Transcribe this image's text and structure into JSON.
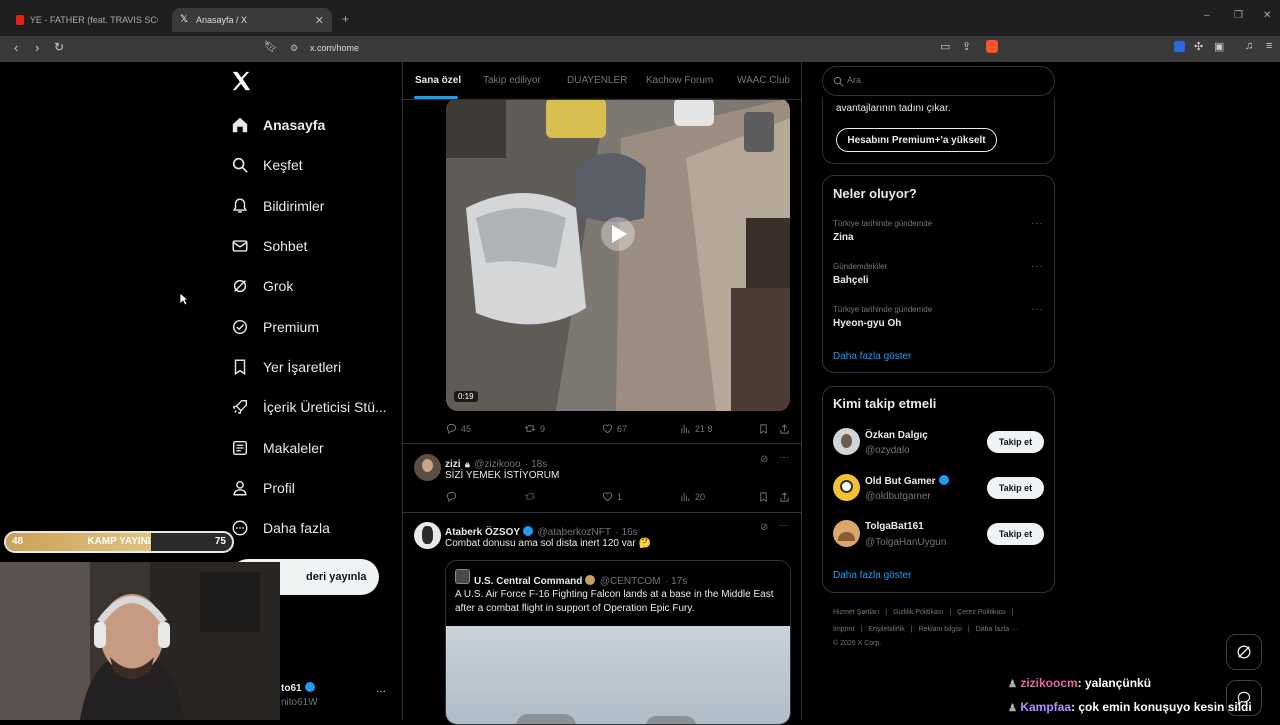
{
  "browser": {
    "tabs": [
      {
        "label": "YE - FATHER (feat. TRAVIS SCOTT) - Y"
      },
      {
        "label": "Anasayfa / X"
      }
    ],
    "new_tab": "+",
    "url": "x.com/home",
    "window_controls": [
      "–",
      "❐",
      "✕"
    ]
  },
  "nav": {
    "items": [
      {
        "label": "Anasayfa",
        "icon": "home-icon"
      },
      {
        "label": "Keşfet",
        "icon": "search-icon"
      },
      {
        "label": "Bildirimler",
        "icon": "bell-icon"
      },
      {
        "label": "Sohbet",
        "icon": "mail-icon"
      },
      {
        "label": "Grok",
        "icon": "grok-icon"
      },
      {
        "label": "Premium",
        "icon": "premium-icon"
      },
      {
        "label": "Yer İşaretleri",
        "icon": "bookmark-icon"
      },
      {
        "label": "İçerik Üreticisi Stü...",
        "icon": "rocket-icon"
      },
      {
        "label": "Makaleler",
        "icon": "article-icon"
      },
      {
        "label": "Profil",
        "icon": "person-icon"
      },
      {
        "label": "Daha fazla",
        "icon": "more-circle-icon"
      }
    ],
    "post_button": "deri yayınla",
    "account_name": "to61",
    "account_handle": "nito61W",
    "account_more": "···"
  },
  "feed": {
    "tabs": [
      "Sana özel",
      "Takip ediliyor",
      "DUAYENLER",
      "Kachow Forum",
      "WAAC Club"
    ],
    "video_duration": "0:19",
    "first_tweet_actions": {
      "replies": "45",
      "reposts": "9",
      "likes": "67",
      "views": "21 8"
    },
    "tweets": [
      {
        "name": "zizi",
        "handle": "@zizikooo",
        "time": "· 18s",
        "text": "SİZİ YEMEK İSTİYORUM",
        "likes": "1",
        "views": "20"
      },
      {
        "name": "Ataberk ÖZSOY",
        "handle": "@ataberkozNFT",
        "time": "· 16s",
        "text": "Combat donusu ama sol dista inert 120 var 🤔",
        "quote": {
          "name": "U.S. Central Command",
          "handle": "@CENTCOM",
          "time": "· 17s",
          "text_line1": "A U.S. Air Force F-16 Fighting Falcon lands at a base in the Middle East",
          "text_line2": "after a combat flight in support of Operation Epic Fury."
        }
      }
    ]
  },
  "right": {
    "search_placeholder": "Ara",
    "premium": {
      "text": "avantajlarının tadını çıkar.",
      "button": "Hesabını Premium+'a yükselt"
    },
    "trends": {
      "title": "Neler oluyor?",
      "items": [
        {
          "meta": "Türkiye tarihinde gündemde",
          "name": "Zina"
        },
        {
          "meta": "Gündemdekiler",
          "name": "Bahçeli"
        },
        {
          "meta": "Türkiye tarihinde gündemde",
          "name": "Hyeon-gyu Oh"
        }
      ],
      "show_more": "Daha fazla göster"
    },
    "who_to_follow": {
      "title": "Kimi takip etmeli",
      "items": [
        {
          "name": "Özkan Dalgıç",
          "handle": "@ozydalo",
          "button": "Takip et"
        },
        {
          "name": "Old But Gamer",
          "handle": "@oldbutgamer",
          "button": "Takip et"
        },
        {
          "name": "TolgaBat161",
          "handle": "@TolgaHanUygun",
          "button": "Takip et"
        }
      ],
      "show_more": "Daha fazla göster"
    },
    "footer": {
      "line1": [
        "Hizmet Şartları",
        "|",
        "Gizlilik Politikası",
        "|",
        "Çerez Politikası",
        "|"
      ],
      "line2": [
        "Imprint",
        "|",
        "Erişilebilirlik",
        "|",
        "Reklam bilgisi",
        "|",
        "Daha fazla ···"
      ],
      "copyright": "© 2026 X Corp."
    }
  },
  "stream_overlay": {
    "bar_left": "48",
    "bar_label": "KAMP YAYINI",
    "bar_right": "75",
    "bar_progress": 0.64,
    "chat": [
      {
        "user": "zizikoocm",
        "message": ": yalançünkü"
      },
      {
        "user": "Kampfaa",
        "message": ": çok emin konuşuyo kesin sildi"
      }
    ]
  },
  "colors": {
    "accent": "#1d9bf0",
    "bg": "#000000",
    "bar_gold": "#c9a25a"
  }
}
